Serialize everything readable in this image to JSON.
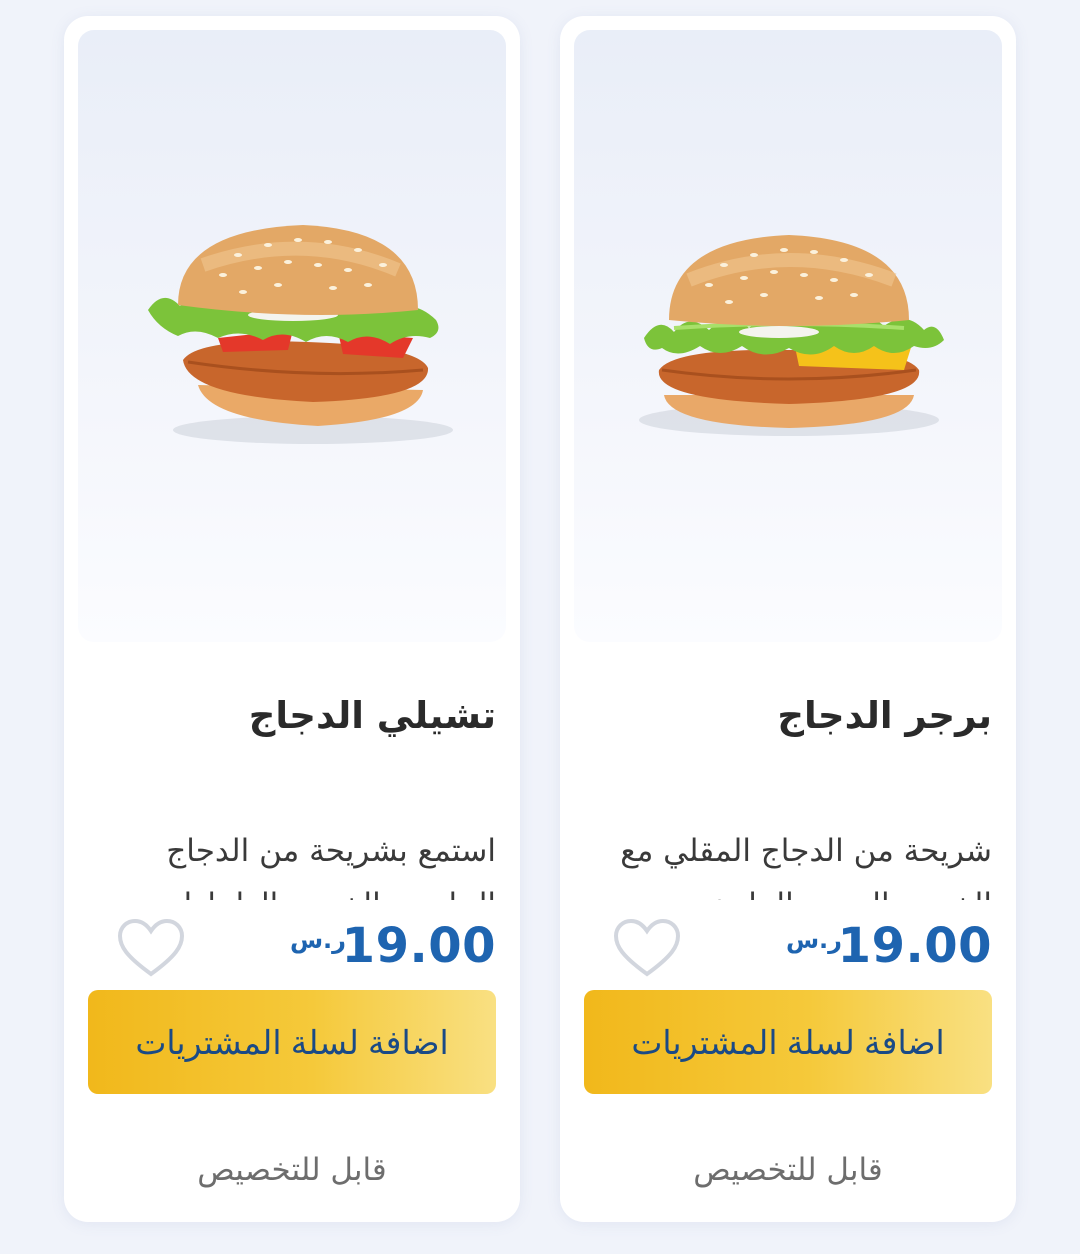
{
  "products": [
    {
      "name": "برجر الدجاج",
      "description": "شريحة من الدجاج المقلي مع الخس والجبن والمايونيز",
      "price": "19.00",
      "currency": "ر.س",
      "add_to_cart_label": "اضافة لسلة المشتريات",
      "customizable_label": "قابل للتخصيص",
      "image_icon": "chicken-burger-image",
      "favorite_icon": "heart-outline-icon"
    },
    {
      "name": "تشيلي الدجاج",
      "description": "استمع بشريحة من الدجاج الحار مع الخس والطماطم",
      "price": "19.00",
      "currency": "ر.س",
      "add_to_cart_label": "اضافة لسلة المشتريات",
      "customizable_label": "قابل للتخصيص",
      "image_icon": "chili-chicken-burger-image",
      "favorite_icon": "heart-outline-icon"
    }
  ],
  "colors": {
    "price": "#1e64b0",
    "button_gradient_start": "#f1b81b",
    "button_gradient_end": "#f9e082",
    "button_text": "#1a4a86",
    "background": "#f0f3fa"
  }
}
